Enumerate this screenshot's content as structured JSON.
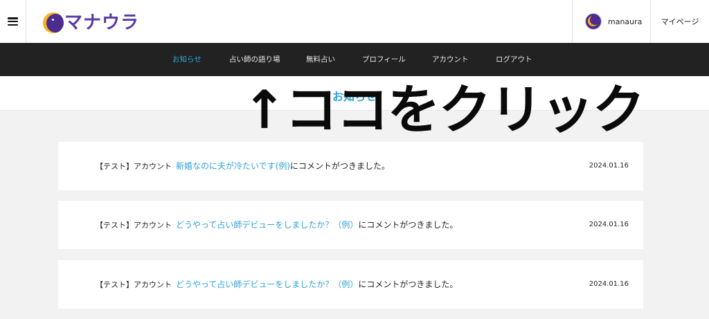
{
  "header": {
    "logo_text": "マナウラ",
    "username": "manaura",
    "mypage_label": "マイページ"
  },
  "nav": {
    "items": [
      {
        "label": "お知らせ",
        "active": true
      },
      {
        "label": "占い師の語り場",
        "active": false
      },
      {
        "label": "無料占い",
        "active": false
      },
      {
        "label": "プロフィール",
        "active": false
      },
      {
        "label": "アカウント",
        "active": false
      },
      {
        "label": "ログアウト",
        "active": false
      }
    ]
  },
  "page": {
    "title": "お知らせ"
  },
  "overlay": {
    "annotation": "↑ココをクリック"
  },
  "notifications": [
    {
      "prefix": "【テスト】アカウント",
      "link_text": "新婚なのに夫が冷たいです(例)",
      "suffix": "にコメントがつきました。",
      "date": "2024.01.16"
    },
    {
      "prefix": "【テスト】アカウント",
      "link_text": "どうやって占い師デビューをしましたか？（例）",
      "suffix": "にコメントがつきました。",
      "date": "2024.01.16"
    },
    {
      "prefix": "【テスト】アカウント",
      "link_text": "どうやって占い師デビューをしましたか？（例）",
      "suffix": "にコメントがつきました。",
      "date": "2024.01.16"
    }
  ],
  "colors": {
    "accent": "#2fa3d6",
    "nav_bg": "#222222",
    "brand_purple": "#5a3aa6",
    "brand_gold": "#f4b321",
    "page_bg": "#f2f2f2"
  }
}
